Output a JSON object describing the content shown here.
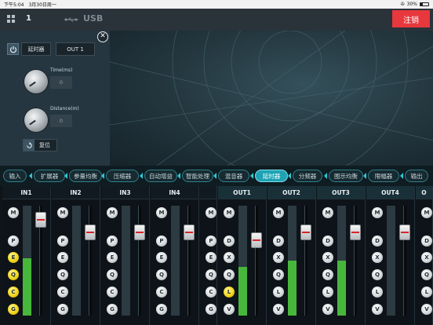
{
  "status_bar": {
    "time": "下午5:04",
    "date": "3月30日周一",
    "battery": "30%"
  },
  "topbar": {
    "preset_number": "1",
    "usb_label": "USB",
    "logout_label": "注销"
  },
  "delay_panel": {
    "title": "延时器",
    "output_select": "OUT 1",
    "time_label": "Time(ms)",
    "time_value": "0",
    "distance_label": "Distance(m)",
    "distance_value": "0",
    "reset_label": "复位"
  },
  "tabs": [
    {
      "label": "输入",
      "active": false
    },
    {
      "label": "扩展器",
      "active": false
    },
    {
      "label": "参量均衡",
      "active": false
    },
    {
      "label": "压缩器",
      "active": false
    },
    {
      "label": "自动增益",
      "active": false
    },
    {
      "label": "智能处理",
      "active": false
    },
    {
      "label": "混音器",
      "active": false
    },
    {
      "label": "延时器",
      "active": true
    },
    {
      "label": "分频器",
      "active": false
    },
    {
      "label": "图示均衡",
      "active": false
    },
    {
      "label": "限幅器",
      "active": false
    },
    {
      "label": "输出",
      "active": false
    }
  ],
  "channels": [
    {
      "name": "IN1",
      "type": "in",
      "buttons": [
        {
          "label": "M",
          "lit": false
        },
        {
          "label": "P",
          "lit": false
        },
        {
          "label": "E",
          "lit": true
        },
        {
          "label": "Q",
          "lit": true
        },
        {
          "label": "C",
          "lit": true
        },
        {
          "label": "G",
          "lit": true
        }
      ],
      "meter_level": 0.52,
      "fader_level": 0.93
    },
    {
      "name": "IN2",
      "type": "in",
      "buttons": [
        {
          "label": "M",
          "lit": false
        },
        {
          "label": "P",
          "lit": false
        },
        {
          "label": "E",
          "lit": false
        },
        {
          "label": "Q",
          "lit": false
        },
        {
          "label": "C",
          "lit": false
        },
        {
          "label": "G",
          "lit": false
        }
      ],
      "meter_level": 0,
      "fader_level": 0.8
    },
    {
      "name": "IN3",
      "type": "in",
      "buttons": [
        {
          "label": "M",
          "lit": false
        },
        {
          "label": "P",
          "lit": false
        },
        {
          "label": "E",
          "lit": false
        },
        {
          "label": "Q",
          "lit": false
        },
        {
          "label": "C",
          "lit": false
        },
        {
          "label": "G",
          "lit": false
        }
      ],
      "meter_level": 0,
      "fader_level": 0.8
    },
    {
      "name": "IN4",
      "type": "in",
      "buttons": [
        {
          "label": "M",
          "lit": false
        },
        {
          "label": "P",
          "lit": false
        },
        {
          "label": "E",
          "lit": false
        },
        {
          "label": "Q",
          "lit": false
        },
        {
          "label": "C",
          "lit": false
        },
        {
          "label": "G",
          "lit": false
        }
      ],
      "meter_level": 0,
      "fader_level": 0.8
    },
    {
      "name": "",
      "type": "in",
      "buttons": [
        {
          "label": "M",
          "lit": false
        },
        {
          "label": "P",
          "lit": false
        },
        {
          "label": "E",
          "lit": false
        },
        {
          "label": "Q",
          "lit": false
        },
        {
          "label": "C",
          "lit": false
        },
        {
          "label": "G",
          "lit": false
        }
      ],
      "meter_level": 0,
      "fader_level": 0.8
    },
    {
      "name": "OUT1",
      "type": "out",
      "buttons": [
        {
          "label": "M",
          "lit": false
        },
        {
          "label": "D",
          "lit": false
        },
        {
          "label": "X",
          "lit": false
        },
        {
          "label": "Q",
          "lit": false
        },
        {
          "label": "L",
          "lit": true
        },
        {
          "label": "V",
          "lit": false
        }
      ],
      "meter_level": 0.44,
      "fader_level": 0.72
    },
    {
      "name": "OUT2",
      "type": "out",
      "buttons": [
        {
          "label": "M",
          "lit": false
        },
        {
          "label": "D",
          "lit": false
        },
        {
          "label": "X",
          "lit": false
        },
        {
          "label": "Q",
          "lit": false
        },
        {
          "label": "L",
          "lit": false
        },
        {
          "label": "V",
          "lit": false
        }
      ],
      "meter_level": 0.5,
      "fader_level": 0.8
    },
    {
      "name": "OUT3",
      "type": "out",
      "buttons": [
        {
          "label": "M",
          "lit": false
        },
        {
          "label": "D",
          "lit": false
        },
        {
          "label": "X",
          "lit": false
        },
        {
          "label": "Q",
          "lit": false
        },
        {
          "label": "L",
          "lit": false
        },
        {
          "label": "V",
          "lit": false
        }
      ],
      "meter_level": 0.5,
      "fader_level": 0.8
    },
    {
      "name": "OUT4",
      "type": "out",
      "buttons": [
        {
          "label": "M",
          "lit": false
        },
        {
          "label": "D",
          "lit": false
        },
        {
          "label": "X",
          "lit": false
        },
        {
          "label": "Q",
          "lit": false
        },
        {
          "label": "L",
          "lit": false
        },
        {
          "label": "V",
          "lit": false
        }
      ],
      "meter_level": 0,
      "fader_level": 0.8
    },
    {
      "name": "O",
      "type": "out",
      "buttons": [
        {
          "label": "M",
          "lit": false
        },
        {
          "label": "D",
          "lit": false
        },
        {
          "label": "X",
          "lit": false
        },
        {
          "label": "Q",
          "lit": false
        },
        {
          "label": "L",
          "lit": false
        },
        {
          "label": "V",
          "lit": false
        }
      ],
      "meter_level": 0,
      "fader_level": 0.8
    }
  ],
  "colors": {
    "accent": "#1fa3b3",
    "logout": "#e8383d",
    "meter": "#47b73b",
    "lit_button": "#f2d51a"
  }
}
